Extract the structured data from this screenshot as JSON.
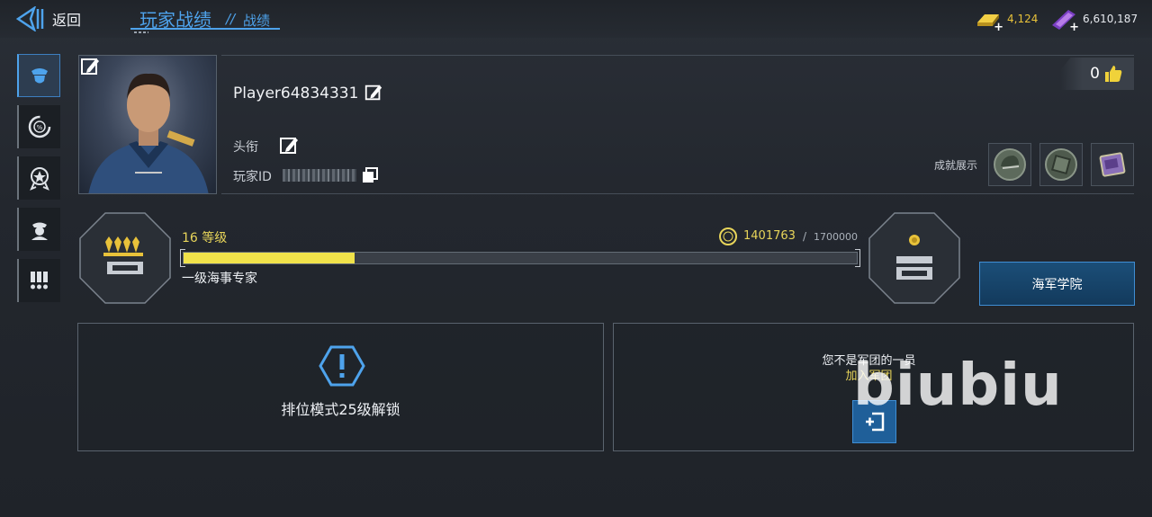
{
  "header": {
    "back_label": "返回",
    "title": "玩家战绩",
    "title_separator": "//",
    "subtitle": "战绩"
  },
  "currencies": [
    {
      "name": "gold-bar-icon",
      "value": "4,124",
      "color": "#e8c23a"
    },
    {
      "name": "purple-ticket-icon",
      "value": "6,610,187",
      "color": "#b77de8"
    }
  ],
  "sidebar": {
    "items": [
      {
        "name": "commander-icon",
        "active": true
      },
      {
        "name": "stats-dial-icon",
        "active": false
      },
      {
        "name": "medal-badge-icon",
        "active": false
      },
      {
        "name": "crew-icon",
        "active": false
      },
      {
        "name": "ribbons-icon",
        "active": false
      }
    ]
  },
  "profile": {
    "player_name": "Player64834331",
    "title_label": "头衔",
    "id_label": "玩家ID",
    "likes": "0",
    "achievements_label": "成就展示"
  },
  "level": {
    "label": "16 等级",
    "xp_current": "1401763",
    "xp_separator": "/",
    "xp_max": "1700000",
    "xp_bar_fill_fraction": 0.254,
    "rank_name": "一级海事专家",
    "academy_button": "海军学院"
  },
  "cards": {
    "ranked_unlock": "排位模式25级解锁",
    "legion_status": "您不是军团的一员",
    "join_legion": "加入军团"
  },
  "watermark": "biubiu",
  "colors": {
    "accent_blue": "#4ea3ec",
    "accent_yellow": "#e8d55a",
    "background": "#23272e"
  }
}
